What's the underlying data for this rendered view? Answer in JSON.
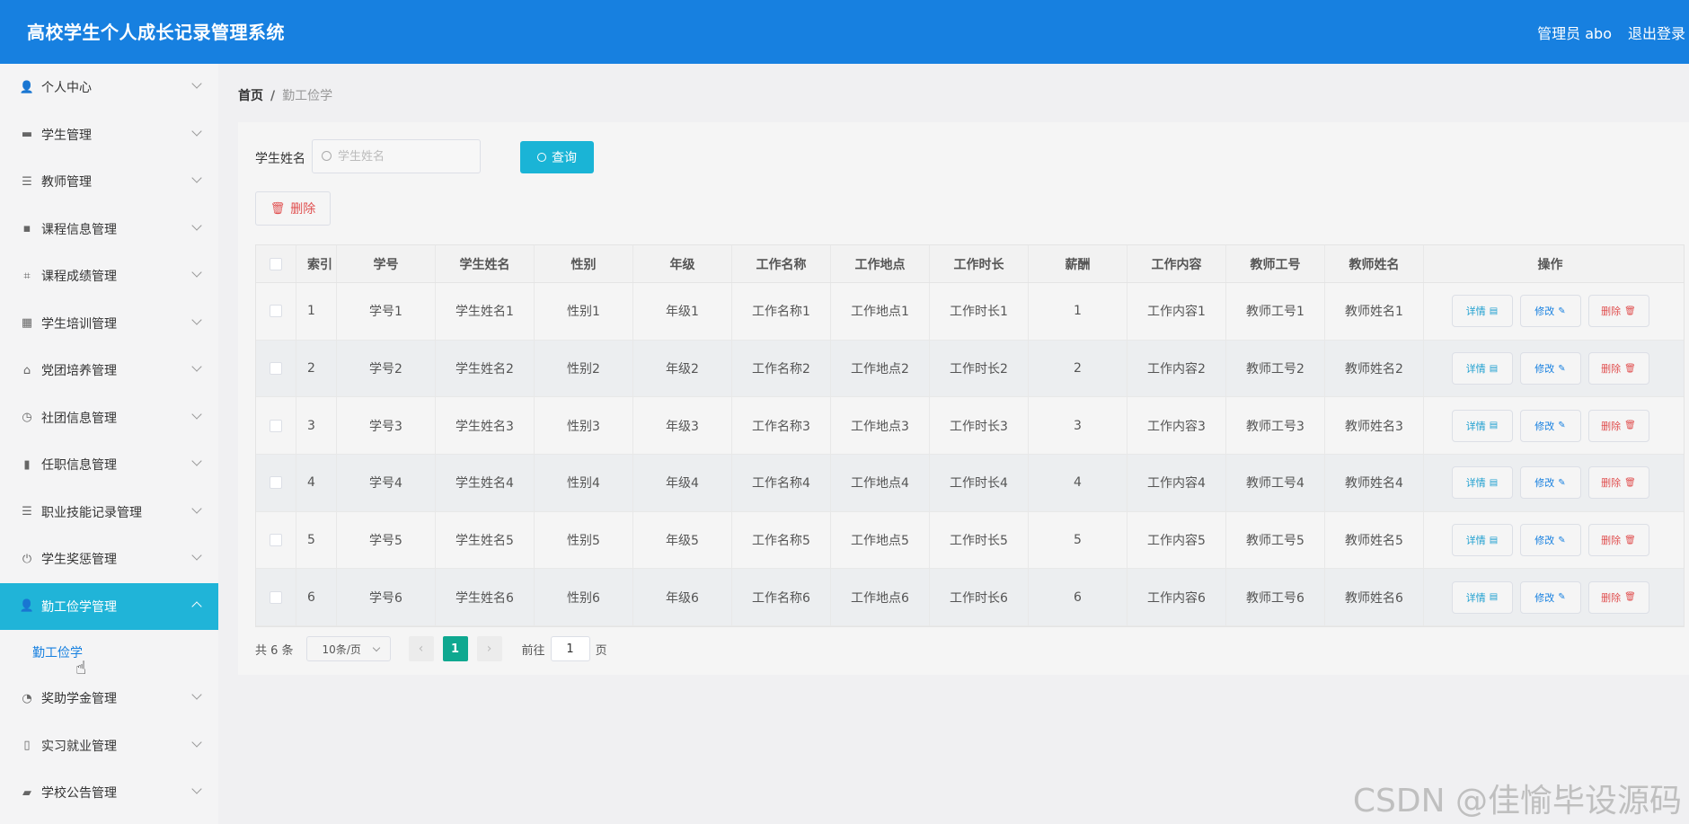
{
  "header": {
    "title": "高校学生个人成长记录管理系统",
    "admin": "管理员 abo",
    "logout": "退出登录"
  },
  "sidebar": {
    "items": [
      {
        "label": "个人中心",
        "icon": "user-icon",
        "glyph": "👤"
      },
      {
        "label": "学生管理",
        "icon": "monitor-icon",
        "glyph": "▬"
      },
      {
        "label": "教师管理",
        "icon": "list-icon",
        "glyph": "☰"
      },
      {
        "label": "课程信息管理",
        "icon": "chat-icon",
        "glyph": "▪"
      },
      {
        "label": "课程成绩管理",
        "icon": "crop-icon",
        "glyph": "⌗"
      },
      {
        "label": "学生培训管理",
        "icon": "grid-icon",
        "glyph": "▦"
      },
      {
        "label": "党团培养管理",
        "icon": "bell-off-icon",
        "glyph": "⌂"
      },
      {
        "label": "社团信息管理",
        "icon": "clock-icon",
        "glyph": "◷"
      },
      {
        "label": "任职信息管理",
        "icon": "bar-chart-icon",
        "glyph": "▮"
      },
      {
        "label": "职业技能记录管理",
        "icon": "menu-icon",
        "glyph": "☰"
      },
      {
        "label": "学生奖惩管理",
        "icon": "power-icon",
        "glyph": "⏻"
      },
      {
        "label": "勤工俭学管理",
        "icon": "user-icon",
        "glyph": "👤",
        "active": true
      },
      {
        "label": "奖助学金管理",
        "icon": "gauge-icon",
        "glyph": "◔"
      },
      {
        "label": "实习就业管理",
        "icon": "microphone-icon",
        "glyph": "▯"
      },
      {
        "label": "学校公告管理",
        "icon": "briefcase-icon",
        "glyph": "▰"
      }
    ],
    "submenu": "勤工俭学"
  },
  "breadcrumb": {
    "home": "首页",
    "sep": "/",
    "current": "勤工俭学"
  },
  "search": {
    "label": "学生姓名",
    "placeholder": "学生姓名",
    "button": "查询"
  },
  "toolbar": {
    "delete_label": "删除"
  },
  "table": {
    "headers": [
      "索引",
      "学号",
      "学生姓名",
      "性别",
      "年级",
      "工作名称",
      "工作地点",
      "工作时长",
      "薪酬",
      "工作内容",
      "教师工号",
      "教师姓名",
      "操作"
    ],
    "rows": [
      [
        "1",
        "学号1",
        "学生姓名1",
        "性别1",
        "年级1",
        "工作名称1",
        "工作地点1",
        "工作时长1",
        "1",
        "工作内容1",
        "教师工号1",
        "教师姓名1"
      ],
      [
        "2",
        "学号2",
        "学生姓名2",
        "性别2",
        "年级2",
        "工作名称2",
        "工作地点2",
        "工作时长2",
        "2",
        "工作内容2",
        "教师工号2",
        "教师姓名2"
      ],
      [
        "3",
        "学号3",
        "学生姓名3",
        "性别3",
        "年级3",
        "工作名称3",
        "工作地点3",
        "工作时长3",
        "3",
        "工作内容3",
        "教师工号3",
        "教师姓名3"
      ],
      [
        "4",
        "学号4",
        "学生姓名4",
        "性别4",
        "年级4",
        "工作名称4",
        "工作地点4",
        "工作时长4",
        "4",
        "工作内容4",
        "教师工号4",
        "教师姓名4"
      ],
      [
        "5",
        "学号5",
        "学生姓名5",
        "性别5",
        "年级5",
        "工作名称5",
        "工作地点5",
        "工作时长5",
        "5",
        "工作内容5",
        "教师工号5",
        "教师姓名5"
      ],
      [
        "6",
        "学号6",
        "学生姓名6",
        "性别6",
        "年级6",
        "工作名称6",
        "工作地点6",
        "工作时长6",
        "6",
        "工作内容6",
        "教师工号6",
        "教师姓名6"
      ]
    ],
    "actions": {
      "detail": "详情",
      "edit": "修改",
      "delete": "删除"
    }
  },
  "pagination": {
    "total": "共 6 条",
    "page_size": "10条/页",
    "current_page": "1",
    "goto_label": "前往",
    "goto_value": "1",
    "page_unit": "页"
  },
  "watermark": "CSDN @佳愉毕设源码",
  "colors": {
    "header_bg": "#1780e0",
    "active_menu": "#20b4d8",
    "query_button": "#1ab4d6",
    "page_active": "#0fa890",
    "danger": "#e05050"
  }
}
